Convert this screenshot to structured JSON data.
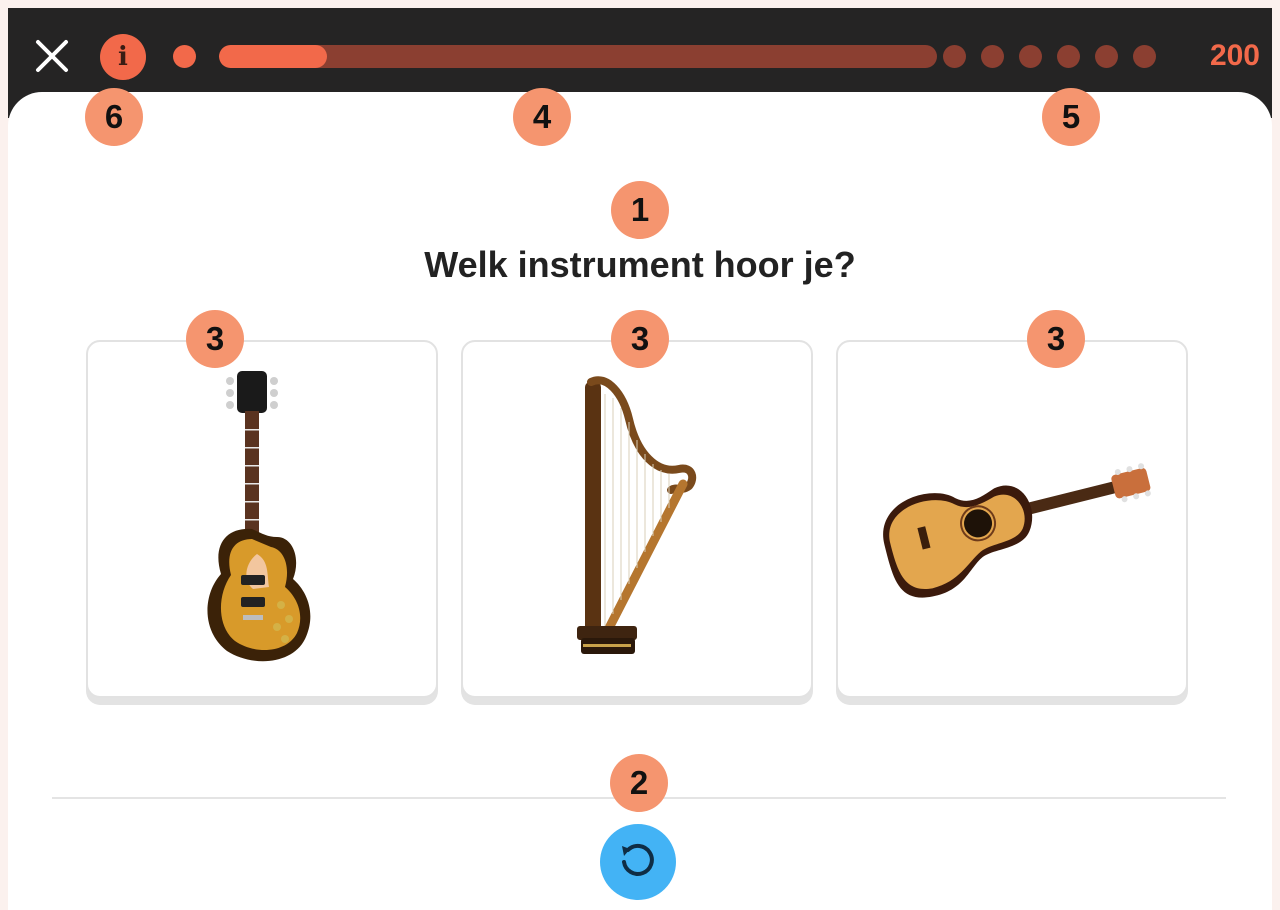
{
  "header": {
    "close_icon": "close-icon",
    "info_icon": "info-icon",
    "info_label": "i",
    "progress_fraction": 0.15,
    "completed_steps": 1,
    "remaining_steps": 6,
    "score": "200"
  },
  "question": {
    "text": "Welk instrument hoor je?"
  },
  "options": [
    {
      "icon": "electric-guitar-icon"
    },
    {
      "icon": "harp-icon"
    },
    {
      "icon": "acoustic-guitar-icon"
    }
  ],
  "controls": {
    "replay_icon": "replay-icon"
  },
  "markers": {
    "m1": "1",
    "m2": "2",
    "m3a": "3",
    "m3b": "3",
    "m3c": "3",
    "m4": "4",
    "m5": "5",
    "m6": "6"
  },
  "colors": {
    "accent": "#f2694a",
    "accent_dark": "#8b3f31",
    "topbar": "#252424",
    "marker": "#f5956f",
    "replay": "#43b3f5"
  }
}
